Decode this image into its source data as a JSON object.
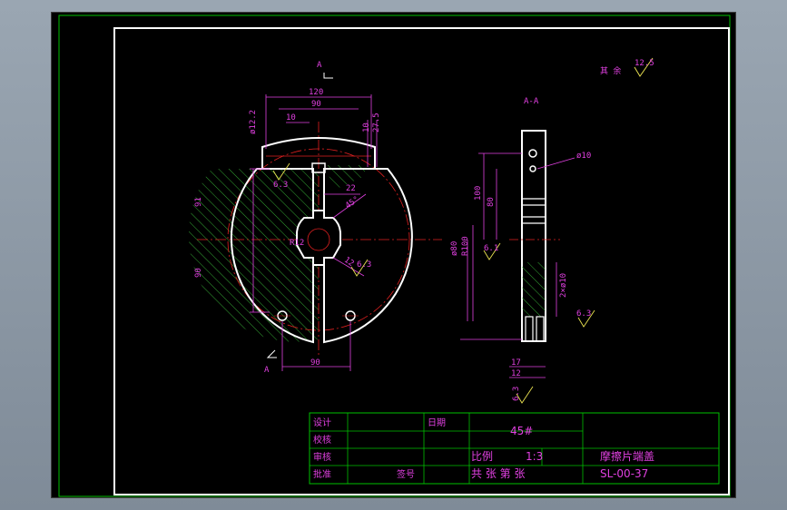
{
  "section_marker": "A",
  "section_title": "A-A",
  "roughness_note": {
    "label": "其 余",
    "value": "12.5"
  },
  "dimensions": {
    "top_width": "120",
    "inner_width": "90",
    "small_width": "10",
    "dia_left": "ø12.2",
    "right_10": "10",
    "right_27": "27.5",
    "upper_height": "91",
    "lower_height": "90",
    "chamfer_22": "22",
    "angle_45": "45°",
    "r12": "R12",
    "keyway_12": "12",
    "bottom_width": "90",
    "aa_dia10": "ø10",
    "aa_h100": "100",
    "aa_h80": "80",
    "aa_dia80": "ø80",
    "aa_r100": "R100",
    "aa_2x10": "2×ø10",
    "aa_17": "17",
    "aa_12": "12"
  },
  "roughness_marks": [
    "6.3",
    "6.3",
    "6.1",
    "6.3",
    "6.3"
  ],
  "title_block": {
    "design": "设计",
    "check": "校核",
    "review": "审核",
    "approve": "批准",
    "date": "日期",
    "seal": "签号",
    "material": "45#",
    "scale_label": "比例",
    "scale_value": "1:3",
    "part_name": "摩擦片端盖",
    "sheets": "共 张 第 张",
    "drawing_no": "SL-00-37"
  },
  "colors": {
    "frame": "#ffffff",
    "outer_border": "#00c000",
    "contour": "#ffffff",
    "dimension": "#e040e0",
    "hatch": "#40d040",
    "center": "#e02020",
    "aux": "#e8e050",
    "table_line": "#00c000"
  }
}
